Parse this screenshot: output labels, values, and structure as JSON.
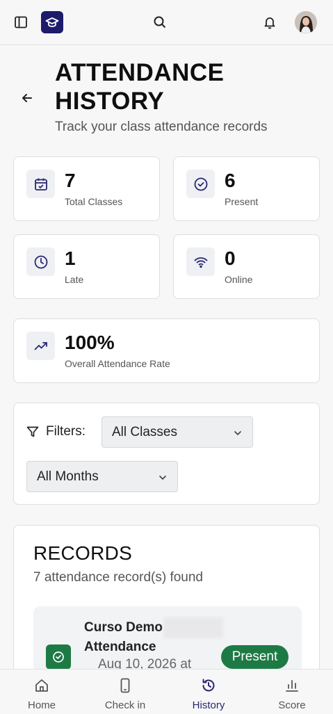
{
  "topbar": {
    "icons": [
      "sidebar-toggle-icon",
      "graduation-cap-icon",
      "search-icon",
      "bell-icon",
      "avatar"
    ]
  },
  "header": {
    "title_line1": "ATTENDANCE",
    "title_line2": "HISTORY",
    "subtitle": "Track your class attendance records"
  },
  "stats": [
    {
      "value": "7",
      "label": "Total Classes",
      "icon": "calendar-check-icon"
    },
    {
      "value": "6",
      "label": "Present",
      "icon": "check-circle-icon"
    },
    {
      "value": "1",
      "label": "Late",
      "icon": "clock-icon"
    },
    {
      "value": "0",
      "label": "Online",
      "icon": "wifi-icon"
    }
  ],
  "overall": {
    "value": "100%",
    "label": "Overall Attendance Rate",
    "icon": "trending-up-icon"
  },
  "filters": {
    "label": "Filters:",
    "class_select": "All Classes",
    "month_select": "All Months"
  },
  "records": {
    "title": "RECORDS",
    "count_text": "7 attendance record(s) found",
    "items": [
      {
        "title": "Curso Demo Attendance",
        "date": "Aug 10, 2026 at",
        "status": "Present"
      }
    ]
  },
  "bottom_nav": [
    {
      "label": "Home",
      "icon": "home-icon"
    },
    {
      "label": "Check in",
      "icon": "phone-icon"
    },
    {
      "label": "History",
      "icon": "history-icon"
    },
    {
      "label": "Score",
      "icon": "bar-chart-icon"
    }
  ],
  "colors": {
    "accent": "#2a2670",
    "success": "#1e7a45",
    "logo_bg": "#1e1b6b"
  }
}
